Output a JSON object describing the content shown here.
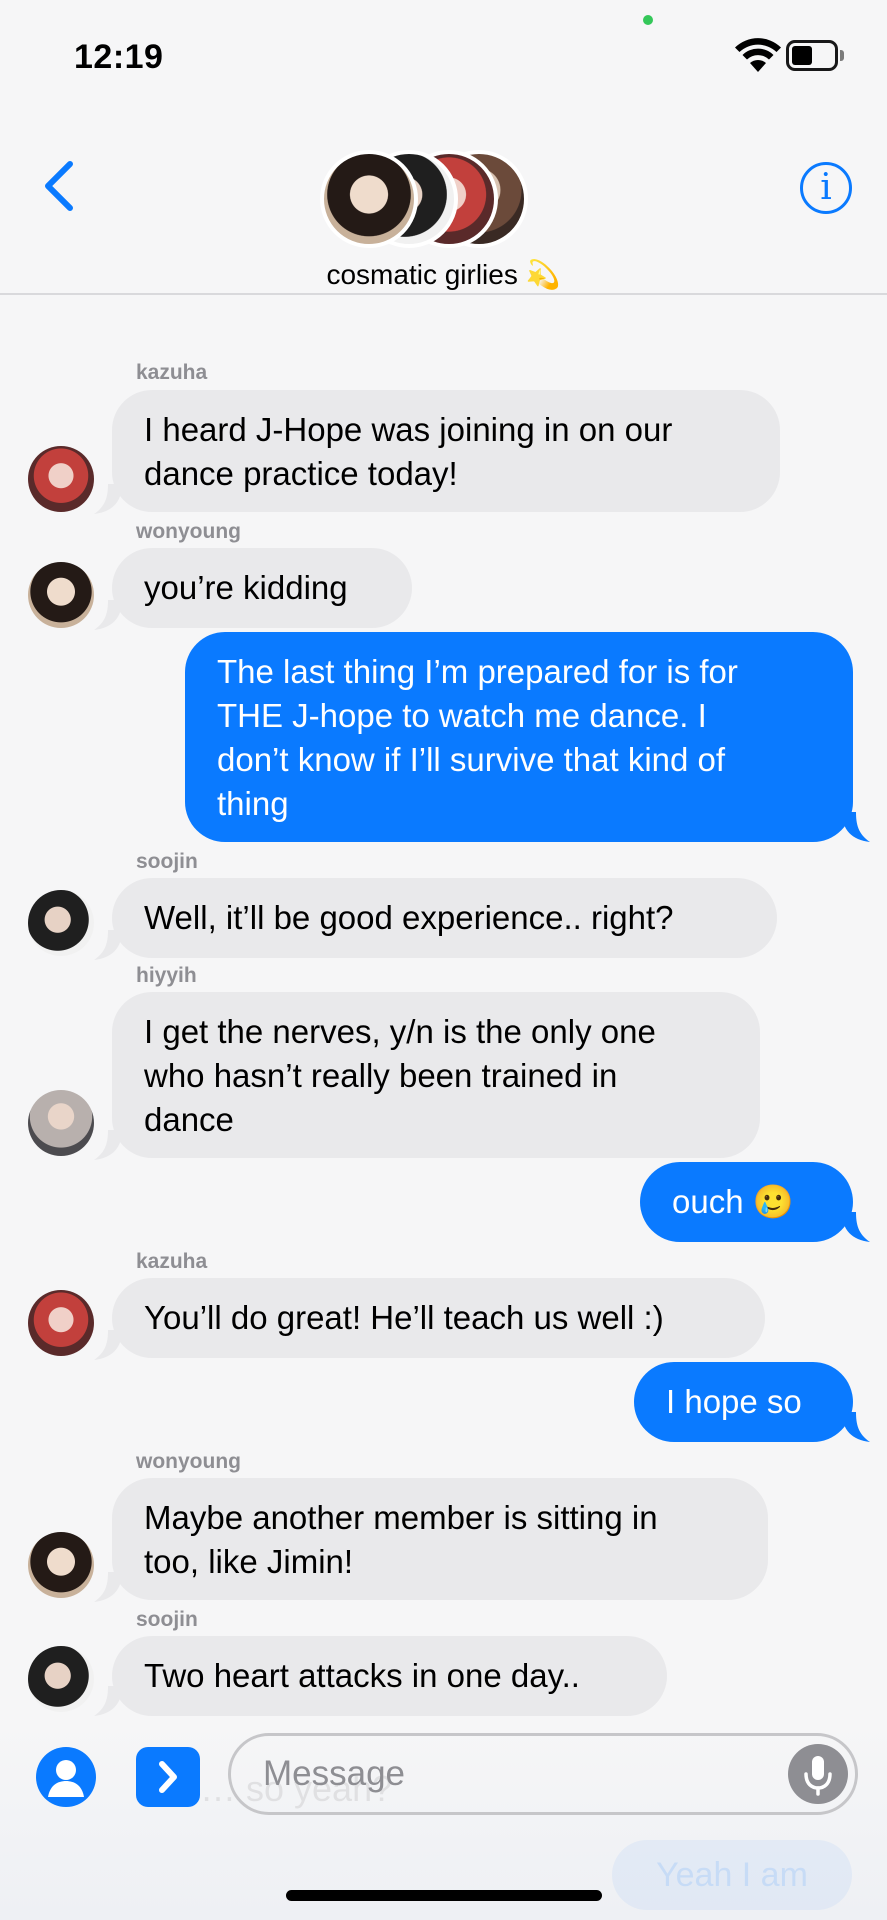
{
  "status": {
    "time": "12:19"
  },
  "header": {
    "back_icon": "chevron-left-icon",
    "group_name": "cosmatic girlies",
    "group_emoji": "💫",
    "info_label": "i"
  },
  "messages": [
    {
      "sender": "kazuha",
      "text_lines": [
        "I heard J-Hope was joining in on our",
        "dance practice today!"
      ],
      "direction": "incoming"
    },
    {
      "sender": "wonyoung",
      "text_lines": [
        "you’re kidding"
      ],
      "direction": "incoming"
    },
    {
      "sender": "",
      "text_lines": [
        "The last thing I’m prepared for is for",
        "THE J-hope to watch me dance. I",
        "don’t know if I’ll survive that kind of",
        "thing"
      ],
      "direction": "outgoing"
    },
    {
      "sender": "soojin",
      "text_lines": [
        "Well, it’ll be good experience.. right?"
      ],
      "direction": "incoming"
    },
    {
      "sender": "hiyyih",
      "text_lines": [
        "I get the nerves, y/n is the only one",
        "who hasn’t really been trained in",
        "dance"
      ],
      "direction": "incoming"
    },
    {
      "sender": "",
      "text_lines": [
        "ouch 🥲"
      ],
      "direction": "outgoing"
    },
    {
      "sender": "kazuha",
      "text_lines": [
        "You’ll do great! He’ll teach us well :)"
      ],
      "direction": "incoming"
    },
    {
      "sender": "",
      "text_lines": [
        "I hope so"
      ],
      "direction": "outgoing"
    },
    {
      "sender": "wonyoung",
      "text_lines": [
        "Maybe another member is sitting in",
        "too, like Jimin!"
      ],
      "direction": "incoming"
    },
    {
      "sender": "soojin",
      "text_lines": [
        "Two heart attacks in one day.."
      ],
      "direction": "incoming"
    }
  ],
  "composer": {
    "placeholder": "Message",
    "ghost_text": "… so yeah?",
    "ghost_bubble": "Yeah I am"
  },
  "colors": {
    "accent": "#0a7aff",
    "incoming_bubble": "#e9e9eb",
    "background": "#f6f6f7",
    "sender_label": "#8e8e93"
  }
}
